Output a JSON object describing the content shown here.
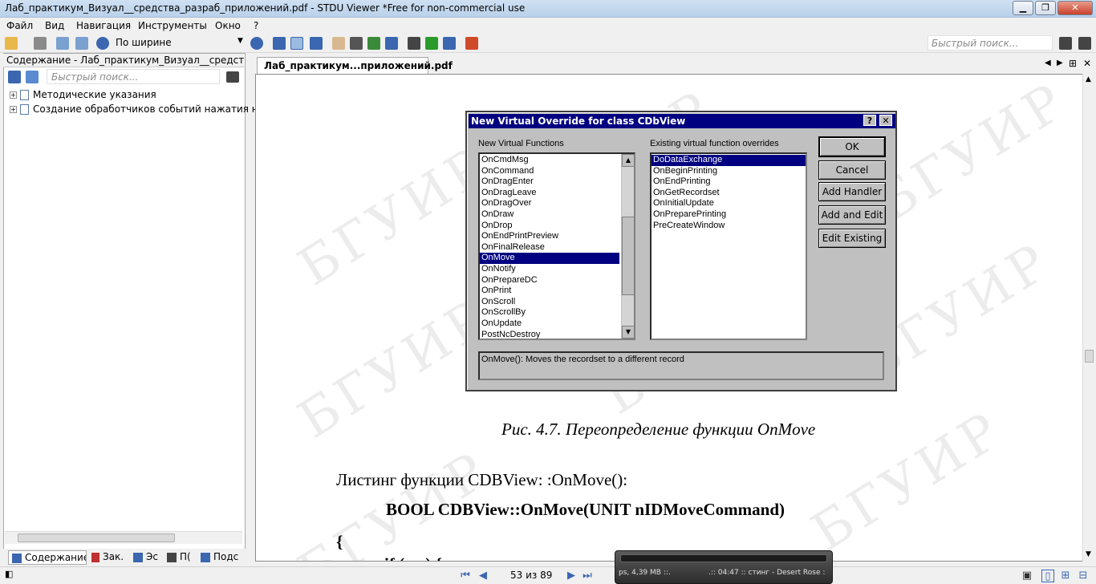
{
  "window": {
    "title": "Лаб_практикум_Визуал__средства_разраб_приложений.pdf - STDU Viewer *Free for non-commercial use",
    "min": "▁",
    "max": "❐",
    "close": "✕"
  },
  "menu": [
    "Файл",
    "Вид",
    "Навигация",
    "Инструменты",
    "Окно",
    "?"
  ],
  "toolbar": {
    "zoom_value": "По ширине",
    "search_placeholder": "Быстрый поиск..."
  },
  "sidebar": {
    "header": "Содержание - Лаб_практикум_Визуал__средства_разраб",
    "search_placeholder": "Быстрый поиск...",
    "items": [
      {
        "label": "Методические указания"
      },
      {
        "label": "Создание обработчиков событий нажатия на"
      }
    ],
    "tabs": [
      "Содержание",
      "Зак.",
      "Эс",
      "П(",
      "Подс"
    ]
  },
  "document": {
    "tab_label": "Лаб_практикум...приложений.pdf",
    "watermark": "БГУИР",
    "caption": "Рис. 4.7. Переопределение функции OnMove",
    "listing_title": "Листинг функции CDBView: :OnMove():",
    "code_line1": "BOOL CDBView::OnMove(UNIT nIDMoveCommand)",
    "code_line2": "{",
    "code_line3": "if ( ... ) {"
  },
  "dialog": {
    "title": "New Virtual Override for class CDbView",
    "help": "?",
    "close": "✕",
    "left_label": "New Virtual Functions",
    "right_label": "Existing virtual function overrides",
    "new_functions": [
      "OnCmdMsg",
      "OnCommand",
      "OnDragEnter",
      "OnDragLeave",
      "OnDragOver",
      "OnDraw",
      "OnDrop",
      "OnEndPrintPreview",
      "OnFinalRelease",
      "OnMove",
      "OnNotify",
      "OnPrepareDC",
      "OnPrint",
      "OnScroll",
      "OnScrollBy",
      "OnUpdate",
      "PostNcDestroy"
    ],
    "selected_new": "OnMove",
    "existing": [
      "DoDataExchange",
      "OnBeginPrinting",
      "OnEndPrinting",
      "OnGetRecordset",
      "OnInitialUpdate",
      "OnPreparePrinting",
      "PreCreateWindow"
    ],
    "selected_existing": "DoDataExchange",
    "buttons": {
      "ok": "OK",
      "cancel": "Cancel",
      "add_handler": "Add Handler",
      "add_edit": "Add and Edit",
      "edit_existing": "Edit Existing"
    },
    "description": "OnMove():  Moves the recordset to a different record"
  },
  "status": {
    "page": "53 из 89",
    "player_left": "ps, 4,39 MB ::.",
    "player_right": ".:: 04:47 :: стинг - Desert Rose :"
  }
}
